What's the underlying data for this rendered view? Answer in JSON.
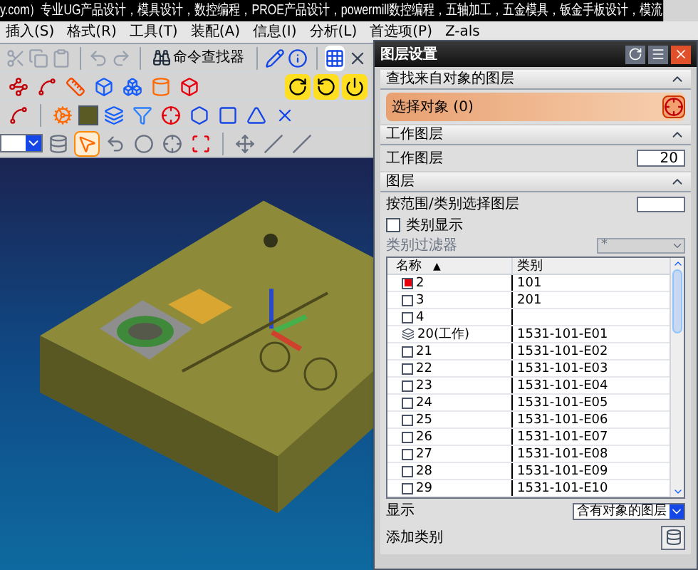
{
  "banner": {
    "text": "y.com）专业UG产品设计，模具设计，数控编程，PROE产品设计，powermill数控编程，五轴加工，五金模具，钣金手板设计，模流"
  },
  "menu": [
    {
      "label": "插入(S)"
    },
    {
      "label": "格式(R)"
    },
    {
      "label": "工具(T)"
    },
    {
      "label": "装配(A)"
    },
    {
      "label": "信息(I)"
    },
    {
      "label": "分析(L)"
    },
    {
      "label": "首选项(P)"
    },
    {
      "label": "Z-als"
    }
  ],
  "toolbar": {
    "command_finder": "命令查找器"
  },
  "dialog": {
    "title": "图层设置",
    "find_section": {
      "title": "查找来自对象的图层",
      "expanded": true,
      "select_label": "选择对象 (0)"
    },
    "work_section": {
      "title": "工作图层",
      "expanded": true,
      "label": "工作图层",
      "value": "20"
    },
    "layers_section": {
      "title": "图层",
      "expanded": true,
      "range_label": "按范围/类别选择图层",
      "category_display": {
        "label": "类别显示",
        "checked": false
      },
      "filter": {
        "label": "类别过滤器",
        "value": "*",
        "disabled": true
      },
      "columns": [
        {
          "label": "名称"
        },
        {
          "label": "类别"
        }
      ],
      "sort_mark": "▲",
      "rows": [
        {
          "kind": "layer",
          "name": "2",
          "checked": true,
          "category": "101"
        },
        {
          "kind": "layer",
          "name": "3",
          "checked": false,
          "category": "201"
        },
        {
          "kind": "layer",
          "name": "4",
          "checked": false,
          "category": ""
        },
        {
          "kind": "work",
          "name": "20(工作)",
          "category": "1531-101-E01"
        },
        {
          "kind": "layer",
          "name": "21",
          "checked": false,
          "category": "1531-101-E02"
        },
        {
          "kind": "layer",
          "name": "22",
          "checked": false,
          "category": "1531-101-E03"
        },
        {
          "kind": "layer",
          "name": "23",
          "checked": false,
          "category": "1531-101-E04"
        },
        {
          "kind": "layer",
          "name": "24",
          "checked": false,
          "category": "1531-101-E05"
        },
        {
          "kind": "layer",
          "name": "25",
          "checked": false,
          "category": "1531-101-E06"
        },
        {
          "kind": "layer",
          "name": "26",
          "checked": false,
          "category": "1531-101-E07"
        },
        {
          "kind": "layer",
          "name": "27",
          "checked": false,
          "category": "1531-101-E08"
        },
        {
          "kind": "layer",
          "name": "28",
          "checked": false,
          "category": "1531-101-E09"
        },
        {
          "kind": "layer",
          "name": "29",
          "checked": false,
          "category": "1531-101-E10"
        }
      ],
      "display": {
        "label": "显示",
        "value": "含有对象的图层"
      },
      "add_category": {
        "label": "添加类别"
      }
    }
  }
}
